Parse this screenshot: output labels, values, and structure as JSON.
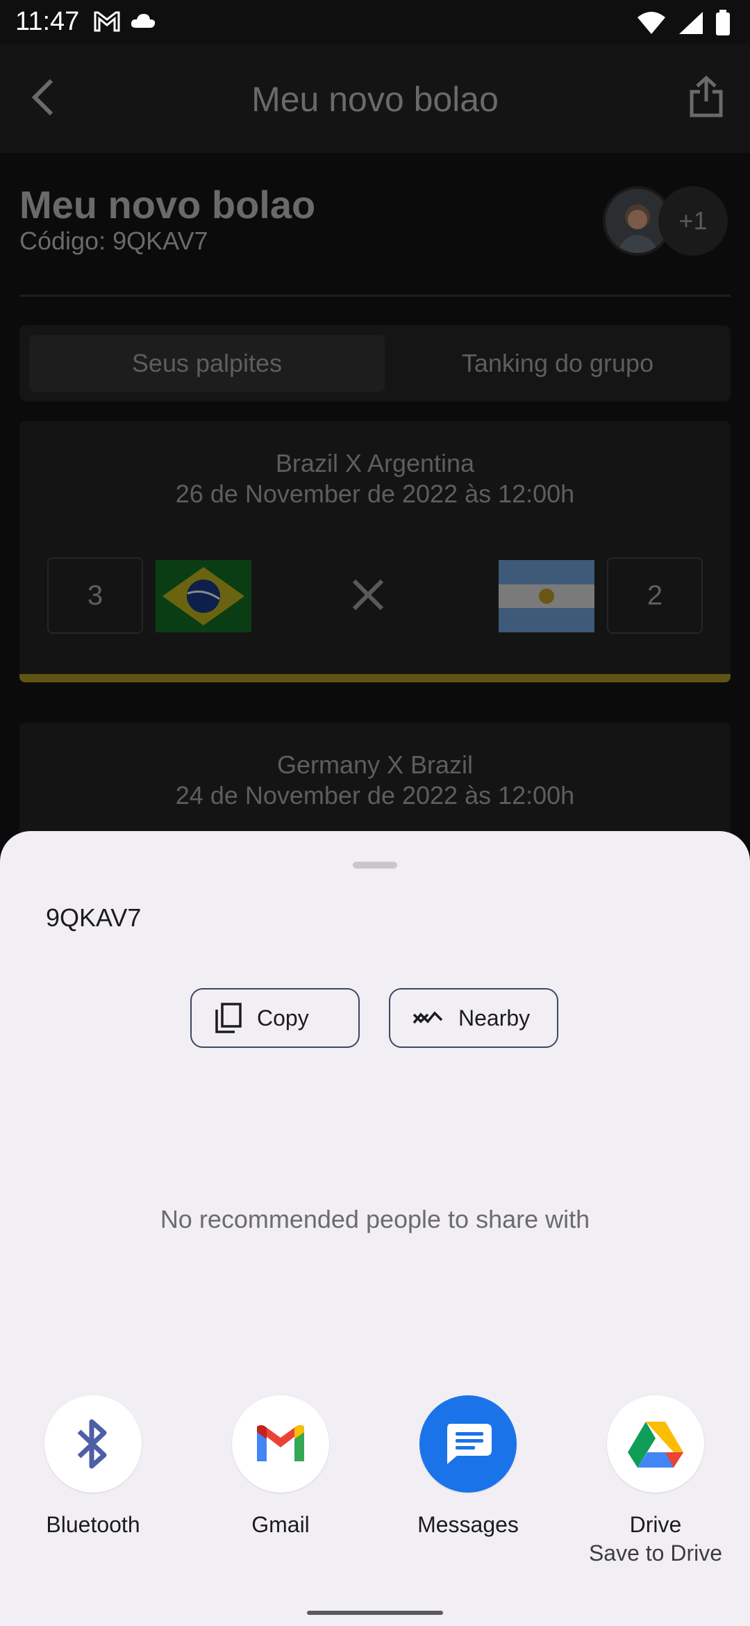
{
  "status_bar": {
    "time": "11:47"
  },
  "app_bar": {
    "title": "Meu novo bolao"
  },
  "header": {
    "title": "Meu novo bolao",
    "code": "Código: 9QKAV7",
    "extra_members": "+1"
  },
  "tabs": [
    {
      "label": "Seus palpites"
    },
    {
      "label": "Tanking do grupo"
    }
  ],
  "matches": [
    {
      "title": "Brazil X Argentina",
      "date": "26 de November de 2022 às 12:00h",
      "home_score": "3",
      "away_score": "2"
    },
    {
      "title": "Germany X Brazil",
      "date": "24 de November de 2022 às 12:00h"
    }
  ],
  "share_sheet": {
    "shared_text": "9QKAV7",
    "copy_label": "Copy",
    "nearby_label": "Nearby",
    "empty_message": "No recommended people to share with",
    "targets": [
      {
        "label": "Bluetooth",
        "icon": "bluetooth-icon"
      },
      {
        "label": "Gmail",
        "icon": "gmail-icon"
      },
      {
        "label": "Messages",
        "icon": "messages-icon"
      },
      {
        "label": "Drive",
        "sublabel": "Save to Drive",
        "icon": "drive-icon"
      }
    ]
  },
  "colors": {
    "sheet_bg": "#f1eff4",
    "outline": "#3b4562",
    "messages_blue": "#1a73e8",
    "card_accent": "#5f5414"
  }
}
